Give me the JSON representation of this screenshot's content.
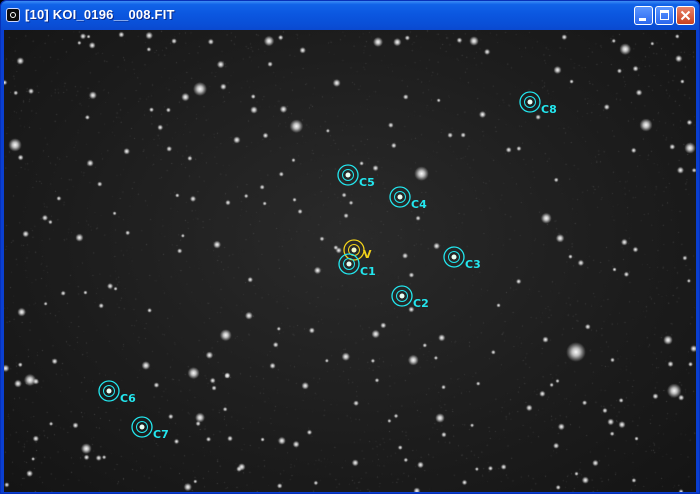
{
  "window": {
    "title": "[10] KOI_0196__008.FIT",
    "icon": "app-icon",
    "controls": [
      "minimize-icon",
      "maximize-icon",
      "close-icon"
    ]
  },
  "colors": {
    "titlebar": "#0b57e0",
    "comparison_marker": "#23e6ee",
    "variable_marker": "#f2d21a",
    "sky_background": "#1c1c1c"
  },
  "markers": {
    "variable": {
      "label": "V"
    },
    "comparison": [
      {
        "label": "C1"
      },
      {
        "label": "C2"
      },
      {
        "label": "C3"
      },
      {
        "label": "C4"
      },
      {
        "label": "C5"
      },
      {
        "label": "C6"
      },
      {
        "label": "C7"
      },
      {
        "label": "C8"
      }
    ]
  }
}
